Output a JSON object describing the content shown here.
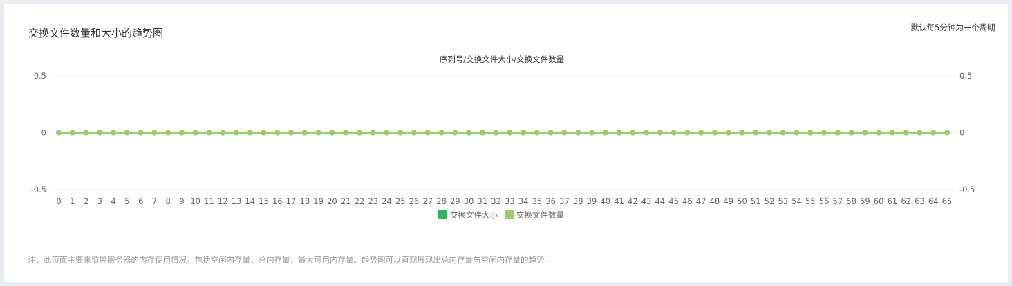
{
  "panel": {
    "title": "交换文件数量和大小的趋势图",
    "period_note": "默认每5分钟为一个周期",
    "footer_note": "注：此页面主要来监控服务器的内存使用情况，包括空闲内存量，总内存量，最大可用内存量。趋势图可以直观展现出总内存量与空闲内存量的趋势。"
  },
  "colors": {
    "size_series": "#2db55d",
    "count_series": "#9ccb6a",
    "grid": "#efefef",
    "axis_text": "#666666"
  },
  "chart_data": {
    "type": "line",
    "title": "序列号/交换文件大小/交换文件数量",
    "x": [
      0,
      1,
      2,
      3,
      4,
      5,
      6,
      7,
      8,
      9,
      10,
      11,
      12,
      13,
      14,
      15,
      16,
      17,
      18,
      19,
      20,
      21,
      22,
      23,
      24,
      25,
      26,
      27,
      28,
      29,
      30,
      31,
      32,
      33,
      34,
      35,
      36,
      37,
      38,
      39,
      40,
      41,
      42,
      43,
      44,
      45,
      46,
      47,
      48,
      49,
      50,
      51,
      52,
      53,
      54,
      55,
      56,
      57,
      58,
      59,
      60,
      61,
      62,
      63,
      64,
      65
    ],
    "ylim": [
      -0.5,
      0.5
    ],
    "y_ticks": [
      0.5,
      0,
      -0.5
    ],
    "y2_ticks": [
      0.5,
      0,
      -0.5
    ],
    "grid": true,
    "legend_position": "bottom-center",
    "series": [
      {
        "name": "交换文件大小",
        "axis": "left",
        "values": [
          0,
          0,
          0,
          0,
          0,
          0,
          0,
          0,
          0,
          0,
          0,
          0,
          0,
          0,
          0,
          0,
          0,
          0,
          0,
          0,
          0,
          0,
          0,
          0,
          0,
          0,
          0,
          0,
          0,
          0,
          0,
          0,
          0,
          0,
          0,
          0,
          0,
          0,
          0,
          0,
          0,
          0,
          0,
          0,
          0,
          0,
          0,
          0,
          0,
          0,
          0,
          0,
          0,
          0,
          0,
          0,
          0,
          0,
          0,
          0,
          0,
          0,
          0,
          0,
          0,
          0
        ]
      },
      {
        "name": "交换文件数量",
        "axis": "right",
        "values": [
          0,
          0,
          0,
          0,
          0,
          0,
          0,
          0,
          0,
          0,
          0,
          0,
          0,
          0,
          0,
          0,
          0,
          0,
          0,
          0,
          0,
          0,
          0,
          0,
          0,
          0,
          0,
          0,
          0,
          0,
          0,
          0,
          0,
          0,
          0,
          0,
          0,
          0,
          0,
          0,
          0,
          0,
          0,
          0,
          0,
          0,
          0,
          0,
          0,
          0,
          0,
          0,
          0,
          0,
          0,
          0,
          0,
          0,
          0,
          0,
          0,
          0,
          0,
          0,
          0,
          0
        ]
      }
    ]
  }
}
